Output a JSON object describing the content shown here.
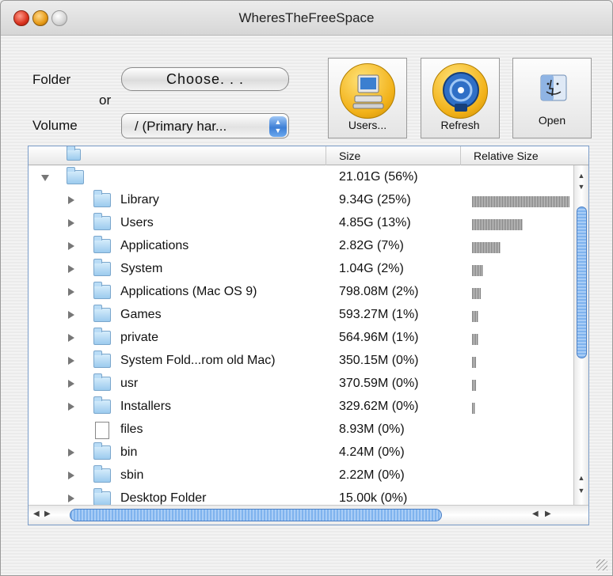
{
  "window": {
    "title": "WheresTheFreeSpace"
  },
  "controls": {
    "folder_label": "Folder",
    "or_label": "or",
    "volume_label": "Volume",
    "choose_button": "Choose. . .",
    "volume_value": "/ (Primary har...",
    "users_button": "Users...",
    "refresh_button": "Refresh",
    "open_button": "Open"
  },
  "table": {
    "columns": [
      "Size",
      "Relative Size"
    ],
    "rows": [
      {
        "name": "",
        "size": "21.01G (56%)",
        "expanded": true,
        "kind": "folder",
        "level": 0,
        "relative": 0
      },
      {
        "name": "Library",
        "size": "9.34G (25%)",
        "expanded": false,
        "kind": "folder",
        "level": 1,
        "relative": 0.44
      },
      {
        "name": "Users",
        "size": "4.85G (13%)",
        "expanded": false,
        "kind": "folder",
        "level": 1,
        "relative": 0.23
      },
      {
        "name": "Applications",
        "size": "2.82G (7%)",
        "expanded": false,
        "kind": "folder",
        "level": 1,
        "relative": 0.13
      },
      {
        "name": "System",
        "size": "1.04G (2%)",
        "expanded": false,
        "kind": "folder",
        "level": 1,
        "relative": 0.05
      },
      {
        "name": "Applications (Mac OS 9)",
        "size": "798.08M (2%)",
        "expanded": false,
        "kind": "folder",
        "level": 1,
        "relative": 0.04
      },
      {
        "name": "Games",
        "size": "593.27M (1%)",
        "expanded": false,
        "kind": "folder",
        "level": 1,
        "relative": 0.03
      },
      {
        "name": "private",
        "size": "564.96M (1%)",
        "expanded": false,
        "kind": "folder",
        "level": 1,
        "relative": 0.03
      },
      {
        "name": "System Fold...rom old Mac)",
        "size": "350.15M (0%)",
        "expanded": false,
        "kind": "folder",
        "level": 1,
        "relative": 0.017
      },
      {
        "name": "usr",
        "size": "370.59M (0%)",
        "expanded": false,
        "kind": "folder",
        "level": 1,
        "relative": 0.018
      },
      {
        "name": "Installers",
        "size": "329.62M (0%)",
        "expanded": false,
        "kind": "folder",
        "level": 1,
        "relative": 0.016
      },
      {
        "name": "files",
        "size": "8.93M (0%)",
        "expanded": false,
        "kind": "file",
        "level": 1,
        "relative": 0
      },
      {
        "name": "bin",
        "size": "4.24M (0%)",
        "expanded": false,
        "kind": "folder",
        "level": 1,
        "relative": 0
      },
      {
        "name": "sbin",
        "size": "2.22M (0%)",
        "expanded": false,
        "kind": "folder",
        "level": 1,
        "relative": 0
      },
      {
        "name": "Desktop Folder",
        "size": "15.00k (0%)",
        "expanded": false,
        "kind": "folder",
        "level": 1,
        "relative": 0
      }
    ]
  }
}
